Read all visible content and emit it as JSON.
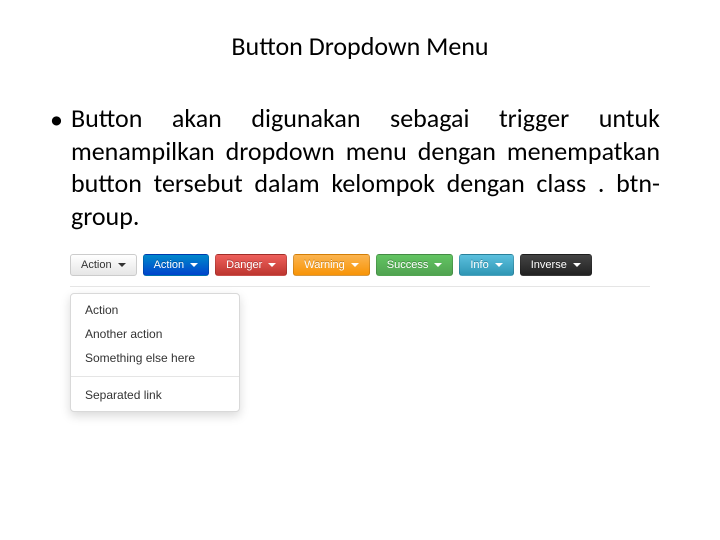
{
  "title": "Button Dropdown Menu",
  "bullet_text": "Button akan digunakan sebagai trigger untuk menampilkan dropdown menu dengan menempatkan button tersebut dalam kelompok dengan class . btn-group.",
  "buttons": [
    {
      "label": "Action",
      "variant": "btn-default"
    },
    {
      "label": "Action",
      "variant": "btn-primary"
    },
    {
      "label": "Danger",
      "variant": "btn-danger"
    },
    {
      "label": "Warning",
      "variant": "btn-warning"
    },
    {
      "label": "Success",
      "variant": "btn-success"
    },
    {
      "label": "Info",
      "variant": "btn-info"
    },
    {
      "label": "Inverse",
      "variant": "btn-inverse"
    }
  ],
  "menu_items": [
    "Action",
    "Another action",
    "Something else here"
  ],
  "menu_separated": "Separated link"
}
